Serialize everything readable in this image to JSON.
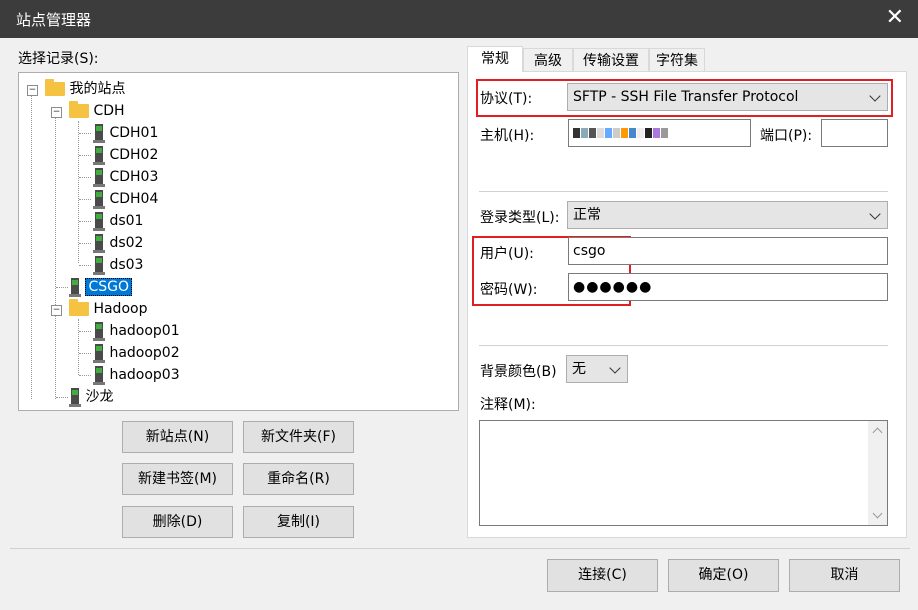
{
  "window": {
    "title": "站点管理器",
    "close_glyph": "✕"
  },
  "tree": {
    "label": "选择记录(S):",
    "nodes": [
      {
        "label": "我的站点",
        "type": "folder"
      },
      {
        "label": "CDH",
        "type": "folder"
      },
      {
        "label": "CDH01",
        "type": "server"
      },
      {
        "label": "CDH02",
        "type": "server"
      },
      {
        "label": "CDH03",
        "type": "server"
      },
      {
        "label": "CDH04",
        "type": "server"
      },
      {
        "label": "ds01",
        "type": "server"
      },
      {
        "label": "ds02",
        "type": "server"
      },
      {
        "label": "ds03",
        "type": "server"
      },
      {
        "label": "CSGO",
        "type": "server",
        "selected": true
      },
      {
        "label": "Hadoop",
        "type": "folder"
      },
      {
        "label": "hadoop01",
        "type": "server"
      },
      {
        "label": "hadoop02",
        "type": "server"
      },
      {
        "label": "hadoop03",
        "type": "server"
      },
      {
        "label": "沙龙",
        "type": "server"
      }
    ]
  },
  "actions": {
    "new_site": "新站点(N)",
    "new_folder": "新文件夹(F)",
    "new_bookmark": "新建书签(M)",
    "rename": "重命名(R)",
    "delete": "删除(D)",
    "copy": "复制(I)"
  },
  "tabs": [
    "常规",
    "高级",
    "传输设置",
    "字符集"
  ],
  "general": {
    "protocol_label": "协议(T):",
    "protocol_value": "SFTP - SSH File Transfer Protocol",
    "host_label": "主机(H):",
    "port_label": "端口(P):",
    "port_value": "",
    "logon_type_label": "登录类型(L):",
    "logon_type_value": "正常",
    "user_label": "用户(U):",
    "user_value": "csgo",
    "password_label": "密码(W):",
    "password_value": "●●●●●●",
    "bg_color_label": "背景颜色(B)",
    "bg_color_value": "无",
    "comment_label": "注释(M):",
    "comment_value": ""
  },
  "footer": {
    "connect": "连接(C)",
    "ok": "确定(O)",
    "cancel": "取消"
  },
  "colors": {
    "highlight": "#e02020",
    "selection": "#0078d7",
    "titlebar": "#3c3c3c"
  },
  "icons": {
    "folder": "folder-icon",
    "server": "server-icon",
    "close": "close-icon",
    "chevron": "chevron-down-icon"
  }
}
